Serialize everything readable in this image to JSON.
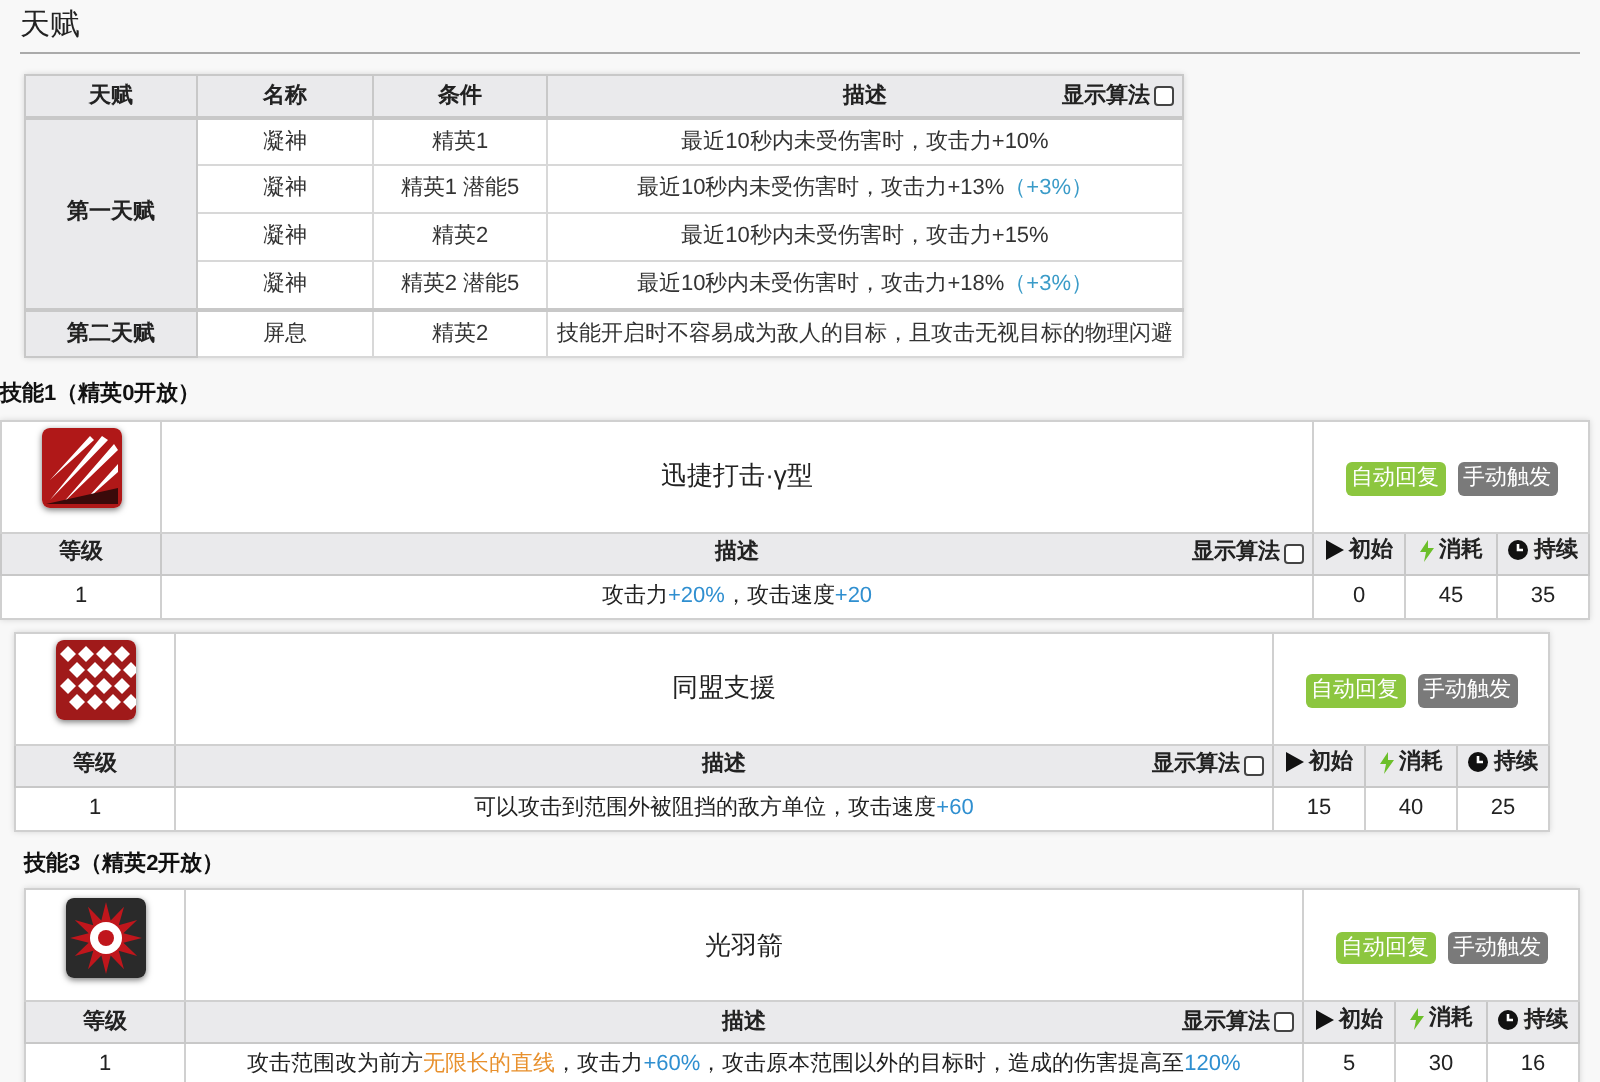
{
  "section_title": "天赋",
  "talent_table": {
    "columns": [
      "天赋",
      "名称",
      "条件",
      "描述"
    ],
    "toggle": {
      "label": "显示算法",
      "checked": false
    },
    "groups": [
      {
        "name": "第一天赋",
        "rows": [
          {
            "name": "凝神",
            "condition": "精英1",
            "description": [
              {
                "kind": "plain",
                "text": "最近10秒内未受伤害时，攻击力+10%"
              }
            ]
          },
          {
            "name": "凝神",
            "condition": "精英1 潜能5",
            "description": [
              {
                "kind": "plain",
                "text": "最近10秒内未受伤害时，攻击力+13%"
              },
              {
                "kind": "bonus",
                "text": "（+3%）"
              }
            ]
          },
          {
            "name": "凝神",
            "condition": "精英2",
            "description": [
              {
                "kind": "plain",
                "text": "最近10秒内未受伤害时，攻击力+15%"
              }
            ]
          },
          {
            "name": "凝神",
            "condition": "精英2 潜能5",
            "description": [
              {
                "kind": "plain",
                "text": "最近10秒内未受伤害时，攻击力+18%"
              },
              {
                "kind": "bonus",
                "text": "（+3%）"
              }
            ]
          }
        ]
      },
      {
        "name": "第二天赋",
        "rows": [
          {
            "name": "屏息",
            "condition": "精英2",
            "description": [
              {
                "kind": "plain",
                "text": "技能开启时不容易成为敌人的目标，且攻击无视目标的物理闪避"
              }
            ]
          }
        ]
      }
    ]
  },
  "skills": [
    {
      "heading": "技能1（精英0开放）",
      "kind": "slash",
      "name": "迅捷打击·γ型",
      "tags": [
        {
          "kind": "recovery",
          "label": "自动回复"
        },
        {
          "kind": "trigger",
          "label": "手动触发"
        }
      ],
      "columns": [
        "等级",
        "描述",
        "初始",
        "消耗",
        "持续"
      ],
      "toggle": {
        "label": "显示算法",
        "checked": false
      },
      "rows": [
        {
          "level": "1",
          "description": [
            {
              "kind": "plain",
              "text": "攻击力"
            },
            {
              "kind": "value",
              "text": "+20%"
            },
            {
              "kind": "plain",
              "text": "，攻击速度"
            },
            {
              "kind": "value",
              "text": "+20"
            }
          ],
          "initial": "0",
          "cost": "45",
          "duration": "35"
        }
      ]
    },
    {
      "kind": "grid",
      "name": "同盟支援",
      "tags": [
        {
          "kind": "recovery",
          "label": "自动回复"
        },
        {
          "kind": "trigger",
          "label": "手动触发"
        }
      ],
      "columns": [
        "等级",
        "描述",
        "初始",
        "消耗",
        "持续"
      ],
      "toggle": {
        "label": "显示算法",
        "checked": false
      },
      "rows": [
        {
          "level": "1",
          "description": [
            {
              "kind": "plain",
              "text": "可以攻击到范围外被阻挡的敌方单位，攻击速度"
            },
            {
              "kind": "value",
              "text": "+60"
            }
          ],
          "initial": "15",
          "cost": "40",
          "duration": "25"
        }
      ]
    },
    {
      "heading": "技能3（精英2开放）",
      "kind": "star",
      "name": "光羽箭",
      "tags": [
        {
          "kind": "recovery",
          "label": "自动回复"
        },
        {
          "kind": "trigger",
          "label": "手动触发"
        }
      ],
      "columns": [
        "等级",
        "描述",
        "初始",
        "消耗",
        "持续"
      ],
      "toggle": {
        "label": "显示算法",
        "checked": false
      },
      "rows": [
        {
          "level": "1",
          "description": [
            {
              "kind": "plain",
              "text": "攻击范围改为前方"
            },
            {
              "kind": "keyword",
              "text": "无限长的直线"
            },
            {
              "kind": "plain",
              "text": "，攻击力"
            },
            {
              "kind": "value",
              "text": "+60%"
            },
            {
              "kind": "plain",
              "text": "，攻击原本范围以外的目标时，造成的伤害提高至"
            },
            {
              "kind": "value",
              "text": "120%"
            }
          ],
          "initial": "5",
          "cost": "30",
          "duration": "16"
        }
      ]
    }
  ]
}
